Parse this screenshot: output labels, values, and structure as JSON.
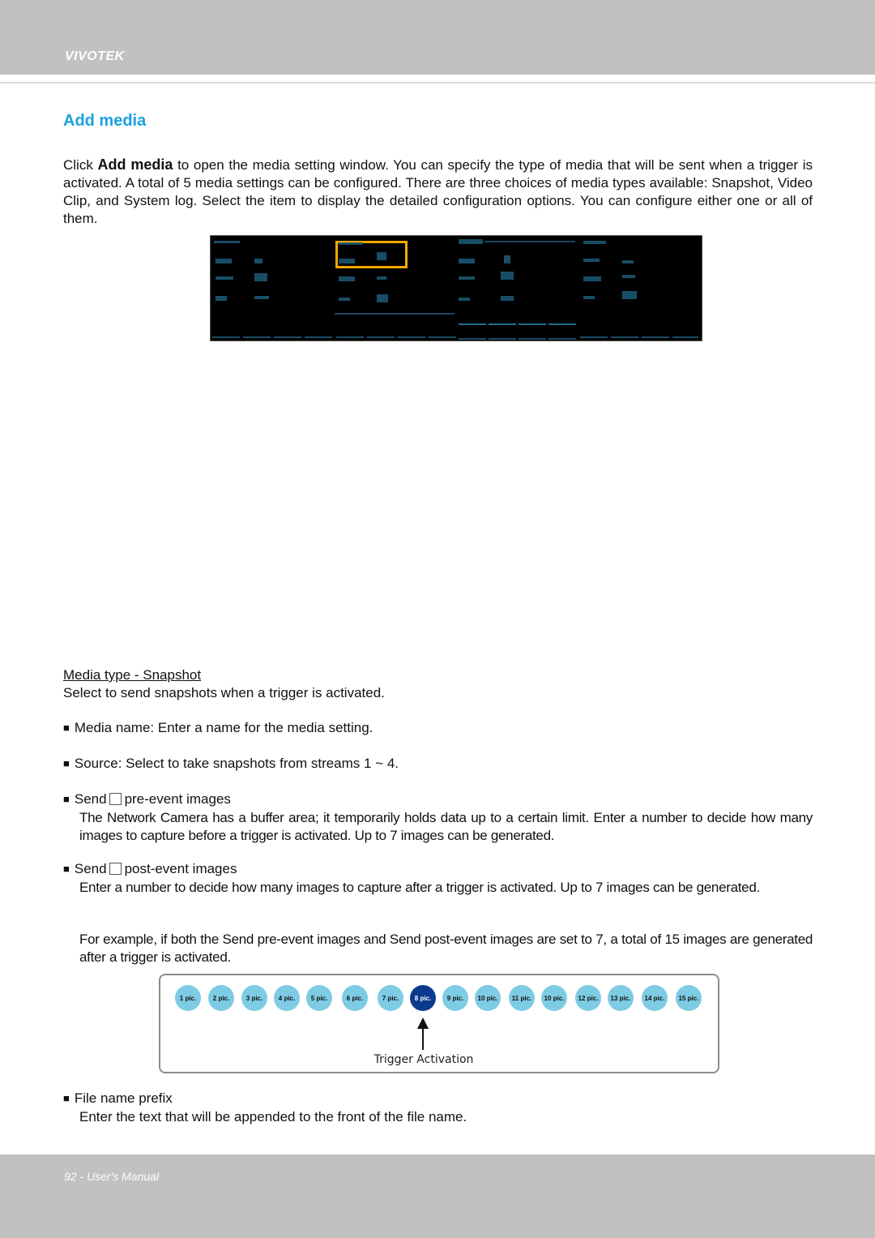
{
  "header": {
    "brand": "VIVOTEK"
  },
  "section": {
    "title": "Add media",
    "intro_prefix": "Click ",
    "intro_bold": "Add media",
    "intro_rest": " to open the media setting window. You can specify the type of media that will be sent when a trigger is activated. A total of 5 media settings can be configured. There are three choices of media types available: Snapshot, Video Clip, and System log. Select the item to display the detailed configuration options. You can configure either one or all of them."
  },
  "screenshot": {
    "description": "Media setting window (low-resolution capture)",
    "highlight_color": "#f2a900"
  },
  "snapshot": {
    "heading": "Media type - Snapshot ",
    "description": "Select to send snapshots when a trigger is activated.",
    "media_name": "Media name: Enter a name for the media setting.",
    "source": "Source: Select to take snapshots from streams 1 ~ 4.",
    "pre_event": {
      "label_before": "Send",
      "label_after": "pre-event images",
      "text": "The Network Camera has a buffer area; it temporarily holds data up to a certain limit. Enter a number to decide how many images to capture before a trigger is activated. Up to 7 images can be generated."
    },
    "post_event": {
      "label_before": "Send",
      "label_after": "post-event images",
      "text": "Enter a number to decide how many images to capture after a trigger is activated. Up to 7 images can be generated."
    },
    "example": "For example, if both the Send pre-event images and Send post-event images are set to 7, a total of 15 images are generated after a trigger is activated.",
    "file_prefix": {
      "label": "File name prefix",
      "text": "Enter the text that will be appended to the front of the file name."
    }
  },
  "timeline": {
    "pics": [
      "1 pic.",
      "2 pic.",
      "3 pic.",
      "4 pic.",
      "5 pic.",
      "6 pic.",
      "7 pic.",
      "8 pic.",
      "9 pic.",
      "10 pic.",
      "11 pic.",
      "10 pic.",
      "12 pic.",
      "13 pic.",
      "14 pic.",
      "15 pic."
    ],
    "selected_index": 7,
    "trigger_label": "Trigger Activation",
    "colors": {
      "pic": "#7ecbe4",
      "selected": "#0c3a8f"
    }
  },
  "footer": {
    "text": "92 - User's Manual"
  }
}
